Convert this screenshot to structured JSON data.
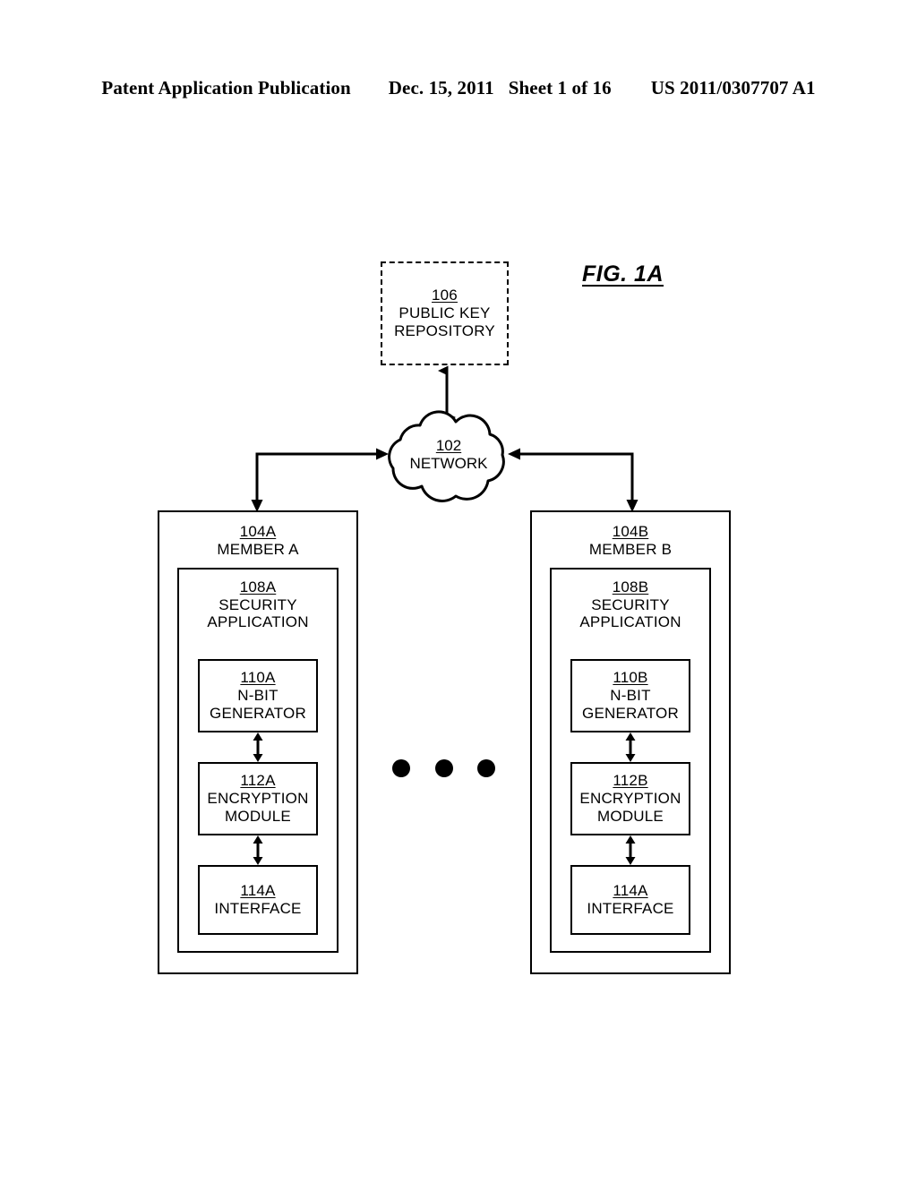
{
  "header": {
    "publication": "Patent Application Publication",
    "date": "Dec. 15, 2011",
    "sheet": "Sheet 1 of 16",
    "patent_number": "US 2011/0307707 A1"
  },
  "figure": {
    "label": "FIG. 1A"
  },
  "repository": {
    "ref": "106",
    "line1": "PUBLIC KEY",
    "line2": "REPOSITORY"
  },
  "network": {
    "ref": "102",
    "name": "NETWORK"
  },
  "members": [
    {
      "ref": "104A",
      "name": "MEMBER A",
      "security_application": {
        "ref": "108A",
        "line1": "SECURITY",
        "line2": "APPLICATION"
      },
      "modules": [
        {
          "ref": "110A",
          "line1": "N-BIT",
          "line2": "GENERATOR"
        },
        {
          "ref": "112A",
          "line1": "ENCRYPTION",
          "line2": "MODULE"
        },
        {
          "ref": "114A",
          "line1": "INTERFACE",
          "line2": ""
        }
      ]
    },
    {
      "ref": "104B",
      "name": "MEMBER B",
      "security_application": {
        "ref": "108B",
        "line1": "SECURITY",
        "line2": "APPLICATION"
      },
      "modules": [
        {
          "ref": "110B",
          "line1": "N-BIT",
          "line2": "GENERATOR"
        },
        {
          "ref": "112B",
          "line1": "ENCRYPTION",
          "line2": "MODULE"
        },
        {
          "ref": "114A",
          "line1": "INTERFACE",
          "line2": ""
        }
      ]
    }
  ],
  "ellipsis": {
    "dot_count": 3
  },
  "colors": {
    "ink": "#000000",
    "page": "#ffffff"
  }
}
